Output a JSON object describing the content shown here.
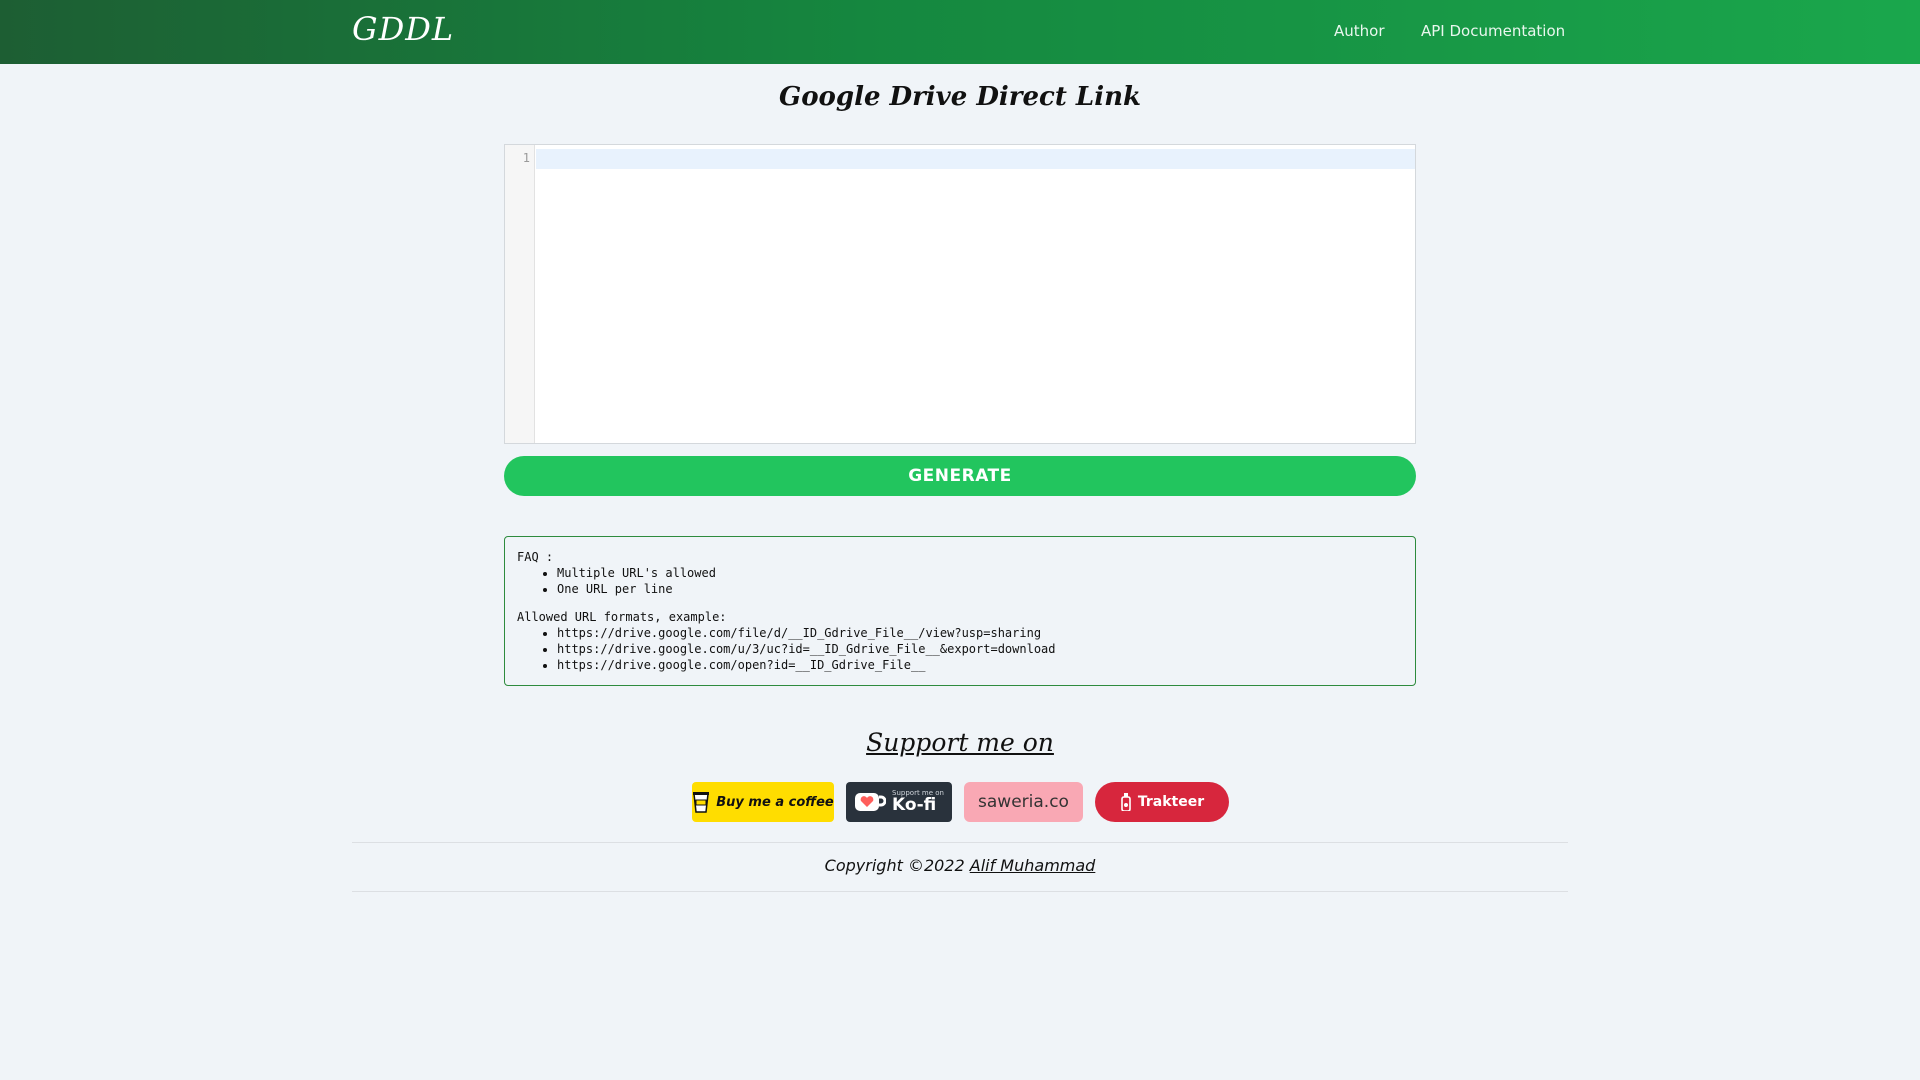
{
  "navbar": {
    "brand": "GDDL",
    "links": [
      {
        "label": "Author"
      },
      {
        "label": "API Documentation"
      }
    ]
  },
  "main": {
    "title": "Google Drive Direct Link",
    "editor": {
      "line_number": "1",
      "value": ""
    },
    "generate_label": "GENERATE"
  },
  "faq": {
    "heading": "FAQ :",
    "items": [
      "Multiple URL's allowed",
      "One URL per line"
    ],
    "formats_heading": "Allowed URL formats, example:",
    "formats": [
      "https://drive.google.com/file/d/__ID_Gdrive_File__/view?usp=sharing",
      "https://drive.google.com/u/3/uc?id=__ID_Gdrive_File__&export=download",
      "https://drive.google.com/open?id=__ID_Gdrive_File__"
    ]
  },
  "support": {
    "title": "Support me on",
    "badges": {
      "bmc": "Buy me a coffee",
      "kofi_small": "Support me on",
      "kofi_big": "Ko-fi",
      "saweria": "saweria.co",
      "trakteer": "Trakteer"
    }
  },
  "footer": {
    "copyright_prefix": "Copyright ©2022",
    "author_name": "Alif Muhammad"
  },
  "colors": {
    "nav_start": "#1d5e33",
    "nav_end": "#1aa74c",
    "generate_button": "#22c55e",
    "faq_border": "#2e8b3e",
    "bmc_yellow": "#ffdd00",
    "kofi_dark": "#29323c",
    "saweria_pink": "#f9a8b4",
    "trakteer_red": "#d7263d"
  },
  "icons": {
    "bmc": "coffee-cup-icon",
    "kofi": "heart-cup-icon",
    "trakteer": "bottle-icon"
  }
}
